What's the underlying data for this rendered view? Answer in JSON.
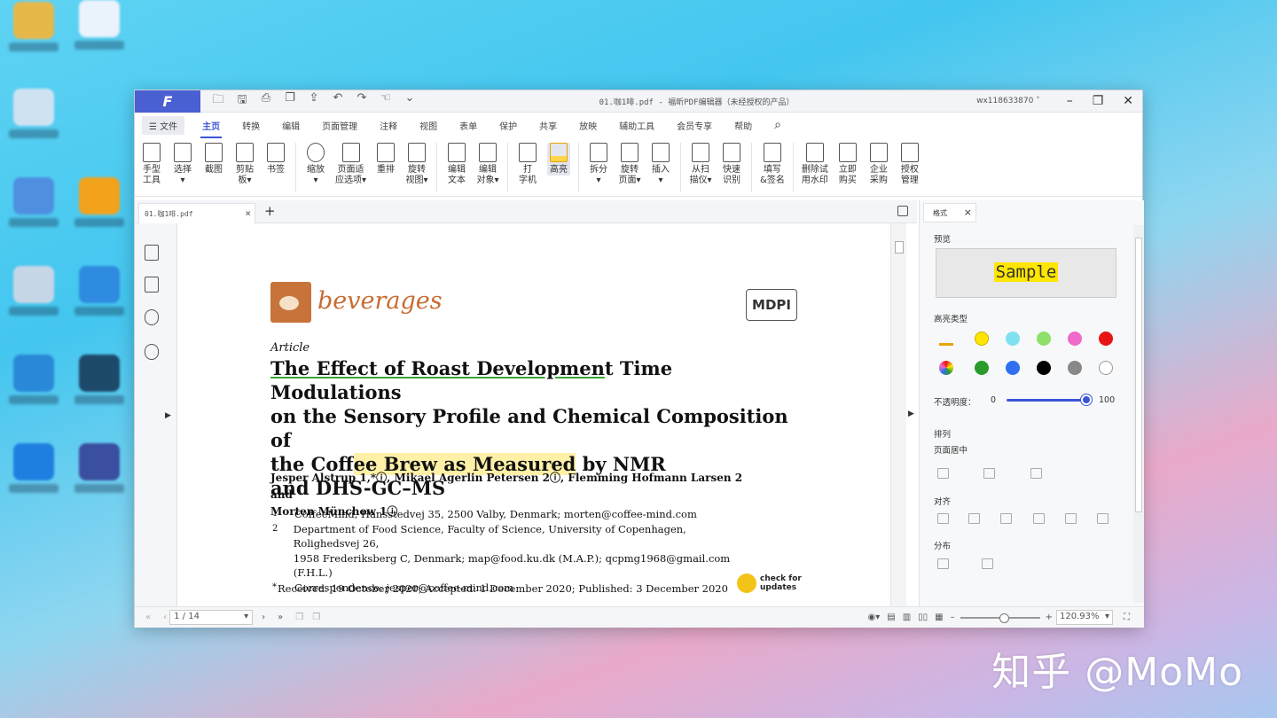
{
  "watermark": "知乎 @MoMo",
  "window": {
    "title": "01.咖1啡.pdf - 福昕PDF编辑器（未经授权的产品）",
    "user": "wx118633870 ˅",
    "logo": "F"
  },
  "menu_tabs": [
    "☰ 文件",
    "主页",
    "转换",
    "编辑",
    "页面管理",
    "注释",
    "视图",
    "表单",
    "保护",
    "共享",
    "放映",
    "辅助工具",
    "会员专享",
    "帮助"
  ],
  "ribbon": [
    {
      "label": "手型\n工具"
    },
    {
      "label": "选择\n▾"
    },
    {
      "label": "截图"
    },
    {
      "label": "剪贴\n板▾"
    },
    {
      "label": "书签"
    },
    {
      "label": "缩放\n▾"
    },
    {
      "label": "页面适\n应选项▾"
    },
    {
      "label": "重排"
    },
    {
      "label": "旋转\n视图▾"
    },
    {
      "label": "编辑\n文本"
    },
    {
      "label": "编辑\n对象▾"
    },
    {
      "label": "打\n字机"
    },
    {
      "label": "高亮"
    },
    {
      "label": "拆分\n▾"
    },
    {
      "label": "旋转\n页面▾"
    },
    {
      "label": "插入\n▾"
    },
    {
      "label": "从扫\n描仪▾"
    },
    {
      "label": "快速\n识别"
    },
    {
      "label": "填写\n&签名"
    },
    {
      "label": "删除试\n用水印"
    },
    {
      "label": "立即\n购买"
    },
    {
      "label": "企业\n采购"
    },
    {
      "label": "授权\n管理"
    }
  ],
  "doc_tab": {
    "name": "01.咖1啡.pdf",
    "close": "×",
    "new": "+"
  },
  "document": {
    "journal": "beverages",
    "publisher": "MDPI",
    "type": "Article",
    "title_ul": "The Effect of Roast Developmen",
    "title_t": "t",
    "title_rest1": " Time Modulations",
    "title_line2": "on the Sensory Profile and Chemical Composition of",
    "title_l3a": "the Cof",
    "title_l3hl": "fee Brew as Measured",
    "title_l3b": " by NMR",
    "title_line4": "and DHS-GC–MS",
    "authors_line1": "Jesper Alstrup 1,*ⓘ, Mikael Agerlin Petersen 2ⓘ, Flemming Hofmann Larsen 2 and",
    "authors_line2": "Morten Münchow 1ⓘ",
    "affiliations": [
      {
        "n": "1",
        "text": "CoffeeMind, Hansstedvej 35, 2500 Valby, Denmark; morten@coffee-mind.com"
      },
      {
        "n": "2",
        "text": "Department of Food Science, Faculty of Science, University of Copenhagen, Rolighedsvej 26,"
      },
      {
        "n": "",
        "text": "1958 Frederiksberg C, Denmark; map@food.ku.dk (M.A.P.); qcpmg1968@gmail.com (F.H.L.)"
      },
      {
        "n": "*",
        "text": "Correspondence: jesper@coffee-mind.com"
      }
    ],
    "received": "Received: 19 October 2020; Accepted: 1 December 2020; Published: 3 December 2020",
    "check1": "check for",
    "check2": "updates"
  },
  "right_panel": {
    "tab": "格式",
    "close": "×",
    "preview_label": "预览",
    "preview_text": "Sample",
    "highlight_type": "高亮类型",
    "opacity_label": "不透明度：",
    "opacity_min": "0",
    "opacity_max": "100",
    "arrange": "排列",
    "center": "页面居中",
    "align": "对齐",
    "distribute": "分布",
    "colors": [
      "#ffe600",
      "#7fe0f0",
      "#8ee06a",
      "#f06ac8",
      "#e81515",
      "#2a9a2a",
      "#2f6ff0",
      "#000000",
      "#888888",
      "#ffffff"
    ]
  },
  "status": {
    "page": "1 / 14",
    "zoom": "120.93%"
  }
}
